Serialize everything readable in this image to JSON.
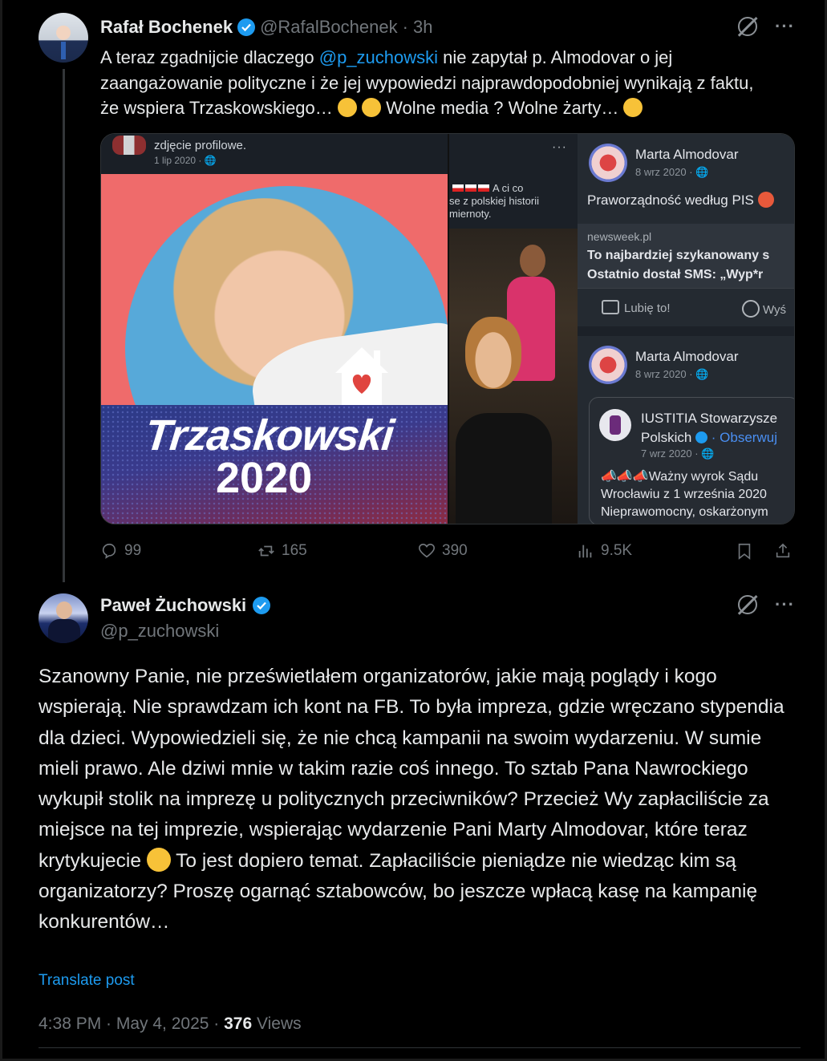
{
  "tweet1": {
    "author_name": "Rafał Bochenek",
    "handle": "@RafalBochenek",
    "time": "· 3h",
    "text_pre": "A teraz zgadnijcie dlaczego ",
    "mention": "@p_zuchowski",
    "text_post": " nie zapytał p. Almodovar o jej zaangażowanie polityczne i że jej wypowiedzi najprawdopodobniej wynikają z faktu, że wspiera Trzaskowskiego…",
    "text_tail1": " Wolne media ? Wolne żarty…",
    "stats": {
      "replies": "99",
      "reposts": "165",
      "likes": "390",
      "views": "9.5K"
    },
    "media": {
      "left": {
        "caption": "zdjęcie profilowe.",
        "date": "1 lip 2020 · ",
        "poster_line1": "Trzaskowski",
        "poster_line2": "2020"
      },
      "middle": {
        "snippet_line1": "A ci co",
        "snippet_line2": "se z polskiej historii",
        "snippet_line3": "miernoty."
      },
      "right": {
        "post1_name": "Marta Almodovar",
        "post1_date": "8 wrz 2020 · ",
        "post1_text": "Praworządność według PIS",
        "link_source": "newsweek.pl",
        "link_title1": "To najbardziej szykanowany s",
        "link_title2": "Ostatnio dostał SMS: „Wyp*r",
        "like_label": "Lubię to!",
        "share_label": "Wyś",
        "post2_name": "Marta Almodovar",
        "post2_date": "8 wrz 2020 · ",
        "shared_name1": "IUSTITIA Stowarzysze",
        "shared_name2": "Polskich",
        "shared_follow": "· Obserwuj",
        "shared_date": "7 wrz 2020 · ",
        "shared_text1": "Ważny wyrok Sądu",
        "shared_text2": "Wrocławiu z 1 września 2020",
        "shared_text3": "Nieprawomocny, oskarżonym"
      }
    }
  },
  "tweet2": {
    "author_name": "Paweł Żuchowski",
    "handle": "@p_zuchowski",
    "text": "Szanowny Panie, nie prześwietlałem organizatorów, jakie mają poglądy i kogo wspierają. Nie sprawdzam ich kont na FB. To była impreza, gdzie wręczano stypendia dla dzieci. Wypowiedzieli się, że nie chcą kampanii na swoim wydarzeniu. W sumie mieli prawo. Ale dziwi mnie w takim razie coś innego. To sztab Pana Nawrockiego wykupił stolik na imprezę u politycznych przeciwników? Przecież Wy zapłaciliście za miejsce na tej imprezie, wspierając wydarzenie Pani Marty Almodovar, które teraz krytykujecie",
    "text_tail": " To jest dopiero temat. Zapłaciliście pieniądze nie wiedząc kim są organizatorzy? Proszę ogarnąć sztabowców, bo jeszcze wpłacą kasę na kampanię konkurentów…",
    "translate_label": "Translate post",
    "timestamp": "4:38 PM · May 4, 2025 · ",
    "views_count": "376",
    "views_label": " Views"
  },
  "icons": {
    "more": "···",
    "accent": "#1d9bf0"
  }
}
